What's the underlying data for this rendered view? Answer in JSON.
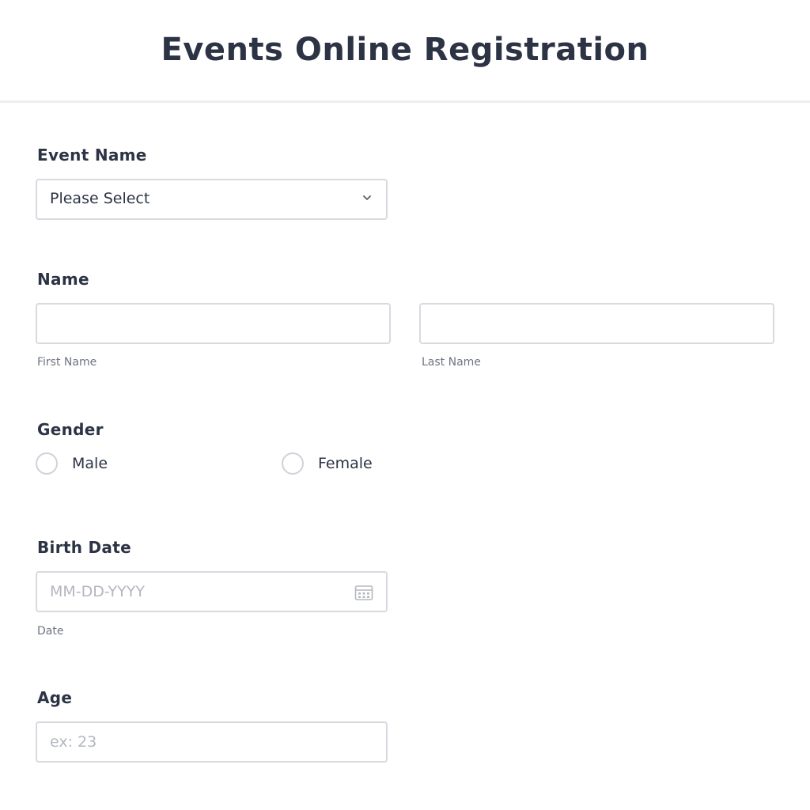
{
  "form": {
    "title": "Events Online Registration"
  },
  "event_name": {
    "label": "Event Name",
    "selected": "Please Select",
    "icon": "chevron-down-icon"
  },
  "name": {
    "label": "Name",
    "first_value": "",
    "last_value": "",
    "first_sublabel": "First Name",
    "last_sublabel": "Last Name"
  },
  "gender": {
    "label": "Gender",
    "options": [
      "Male",
      "Female"
    ]
  },
  "birth_date": {
    "label": "Birth Date",
    "placeholder": "MM-DD-YYYY",
    "sublabel": "Date",
    "icon": "calendar-icon"
  },
  "age": {
    "label": "Age",
    "placeholder": "ex: 23"
  }
}
